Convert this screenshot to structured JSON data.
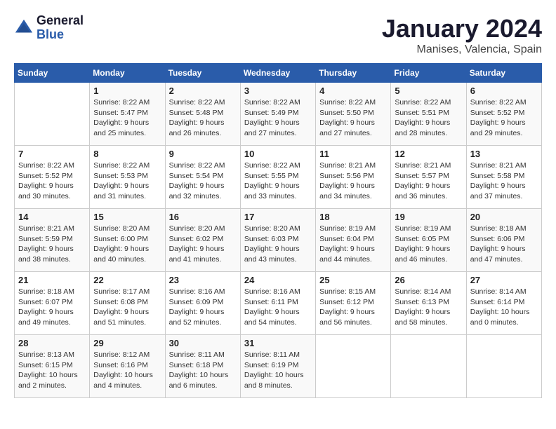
{
  "logo": {
    "line1": "General",
    "line2": "Blue"
  },
  "title": "January 2024",
  "subtitle": "Manises, Valencia, Spain",
  "weekdays": [
    "Sunday",
    "Monday",
    "Tuesday",
    "Wednesday",
    "Thursday",
    "Friday",
    "Saturday"
  ],
  "weeks": [
    [
      {
        "day": "",
        "sunrise": "",
        "sunset": "",
        "daylight": ""
      },
      {
        "day": "1",
        "sunrise": "Sunrise: 8:22 AM",
        "sunset": "Sunset: 5:47 PM",
        "daylight": "Daylight: 9 hours and 25 minutes."
      },
      {
        "day": "2",
        "sunrise": "Sunrise: 8:22 AM",
        "sunset": "Sunset: 5:48 PM",
        "daylight": "Daylight: 9 hours and 26 minutes."
      },
      {
        "day": "3",
        "sunrise": "Sunrise: 8:22 AM",
        "sunset": "Sunset: 5:49 PM",
        "daylight": "Daylight: 9 hours and 27 minutes."
      },
      {
        "day": "4",
        "sunrise": "Sunrise: 8:22 AM",
        "sunset": "Sunset: 5:50 PM",
        "daylight": "Daylight: 9 hours and 27 minutes."
      },
      {
        "day": "5",
        "sunrise": "Sunrise: 8:22 AM",
        "sunset": "Sunset: 5:51 PM",
        "daylight": "Daylight: 9 hours and 28 minutes."
      },
      {
        "day": "6",
        "sunrise": "Sunrise: 8:22 AM",
        "sunset": "Sunset: 5:52 PM",
        "daylight": "Daylight: 9 hours and 29 minutes."
      }
    ],
    [
      {
        "day": "7",
        "sunrise": "Sunrise: 8:22 AM",
        "sunset": "Sunset: 5:52 PM",
        "daylight": "Daylight: 9 hours and 30 minutes."
      },
      {
        "day": "8",
        "sunrise": "Sunrise: 8:22 AM",
        "sunset": "Sunset: 5:53 PM",
        "daylight": "Daylight: 9 hours and 31 minutes."
      },
      {
        "day": "9",
        "sunrise": "Sunrise: 8:22 AM",
        "sunset": "Sunset: 5:54 PM",
        "daylight": "Daylight: 9 hours and 32 minutes."
      },
      {
        "day": "10",
        "sunrise": "Sunrise: 8:22 AM",
        "sunset": "Sunset: 5:55 PM",
        "daylight": "Daylight: 9 hours and 33 minutes."
      },
      {
        "day": "11",
        "sunrise": "Sunrise: 8:21 AM",
        "sunset": "Sunset: 5:56 PM",
        "daylight": "Daylight: 9 hours and 34 minutes."
      },
      {
        "day": "12",
        "sunrise": "Sunrise: 8:21 AM",
        "sunset": "Sunset: 5:57 PM",
        "daylight": "Daylight: 9 hours and 36 minutes."
      },
      {
        "day": "13",
        "sunrise": "Sunrise: 8:21 AM",
        "sunset": "Sunset: 5:58 PM",
        "daylight": "Daylight: 9 hours and 37 minutes."
      }
    ],
    [
      {
        "day": "14",
        "sunrise": "Sunrise: 8:21 AM",
        "sunset": "Sunset: 5:59 PM",
        "daylight": "Daylight: 9 hours and 38 minutes."
      },
      {
        "day": "15",
        "sunrise": "Sunrise: 8:20 AM",
        "sunset": "Sunset: 6:00 PM",
        "daylight": "Daylight: 9 hours and 40 minutes."
      },
      {
        "day": "16",
        "sunrise": "Sunrise: 8:20 AM",
        "sunset": "Sunset: 6:02 PM",
        "daylight": "Daylight: 9 hours and 41 minutes."
      },
      {
        "day": "17",
        "sunrise": "Sunrise: 8:20 AM",
        "sunset": "Sunset: 6:03 PM",
        "daylight": "Daylight: 9 hours and 43 minutes."
      },
      {
        "day": "18",
        "sunrise": "Sunrise: 8:19 AM",
        "sunset": "Sunset: 6:04 PM",
        "daylight": "Daylight: 9 hours and 44 minutes."
      },
      {
        "day": "19",
        "sunrise": "Sunrise: 8:19 AM",
        "sunset": "Sunset: 6:05 PM",
        "daylight": "Daylight: 9 hours and 46 minutes."
      },
      {
        "day": "20",
        "sunrise": "Sunrise: 8:18 AM",
        "sunset": "Sunset: 6:06 PM",
        "daylight": "Daylight: 9 hours and 47 minutes."
      }
    ],
    [
      {
        "day": "21",
        "sunrise": "Sunrise: 8:18 AM",
        "sunset": "Sunset: 6:07 PM",
        "daylight": "Daylight: 9 hours and 49 minutes."
      },
      {
        "day": "22",
        "sunrise": "Sunrise: 8:17 AM",
        "sunset": "Sunset: 6:08 PM",
        "daylight": "Daylight: 9 hours and 51 minutes."
      },
      {
        "day": "23",
        "sunrise": "Sunrise: 8:16 AM",
        "sunset": "Sunset: 6:09 PM",
        "daylight": "Daylight: 9 hours and 52 minutes."
      },
      {
        "day": "24",
        "sunrise": "Sunrise: 8:16 AM",
        "sunset": "Sunset: 6:11 PM",
        "daylight": "Daylight: 9 hours and 54 minutes."
      },
      {
        "day": "25",
        "sunrise": "Sunrise: 8:15 AM",
        "sunset": "Sunset: 6:12 PM",
        "daylight": "Daylight: 9 hours and 56 minutes."
      },
      {
        "day": "26",
        "sunrise": "Sunrise: 8:14 AM",
        "sunset": "Sunset: 6:13 PM",
        "daylight": "Daylight: 9 hours and 58 minutes."
      },
      {
        "day": "27",
        "sunrise": "Sunrise: 8:14 AM",
        "sunset": "Sunset: 6:14 PM",
        "daylight": "Daylight: 10 hours and 0 minutes."
      }
    ],
    [
      {
        "day": "28",
        "sunrise": "Sunrise: 8:13 AM",
        "sunset": "Sunset: 6:15 PM",
        "daylight": "Daylight: 10 hours and 2 minutes."
      },
      {
        "day": "29",
        "sunrise": "Sunrise: 8:12 AM",
        "sunset": "Sunset: 6:16 PM",
        "daylight": "Daylight: 10 hours and 4 minutes."
      },
      {
        "day": "30",
        "sunrise": "Sunrise: 8:11 AM",
        "sunset": "Sunset: 6:18 PM",
        "daylight": "Daylight: 10 hours and 6 minutes."
      },
      {
        "day": "31",
        "sunrise": "Sunrise: 8:11 AM",
        "sunset": "Sunset: 6:19 PM",
        "daylight": "Daylight: 10 hours and 8 minutes."
      },
      {
        "day": "",
        "sunrise": "",
        "sunset": "",
        "daylight": ""
      },
      {
        "day": "",
        "sunrise": "",
        "sunset": "",
        "daylight": ""
      },
      {
        "day": "",
        "sunrise": "",
        "sunset": "",
        "daylight": ""
      }
    ]
  ]
}
